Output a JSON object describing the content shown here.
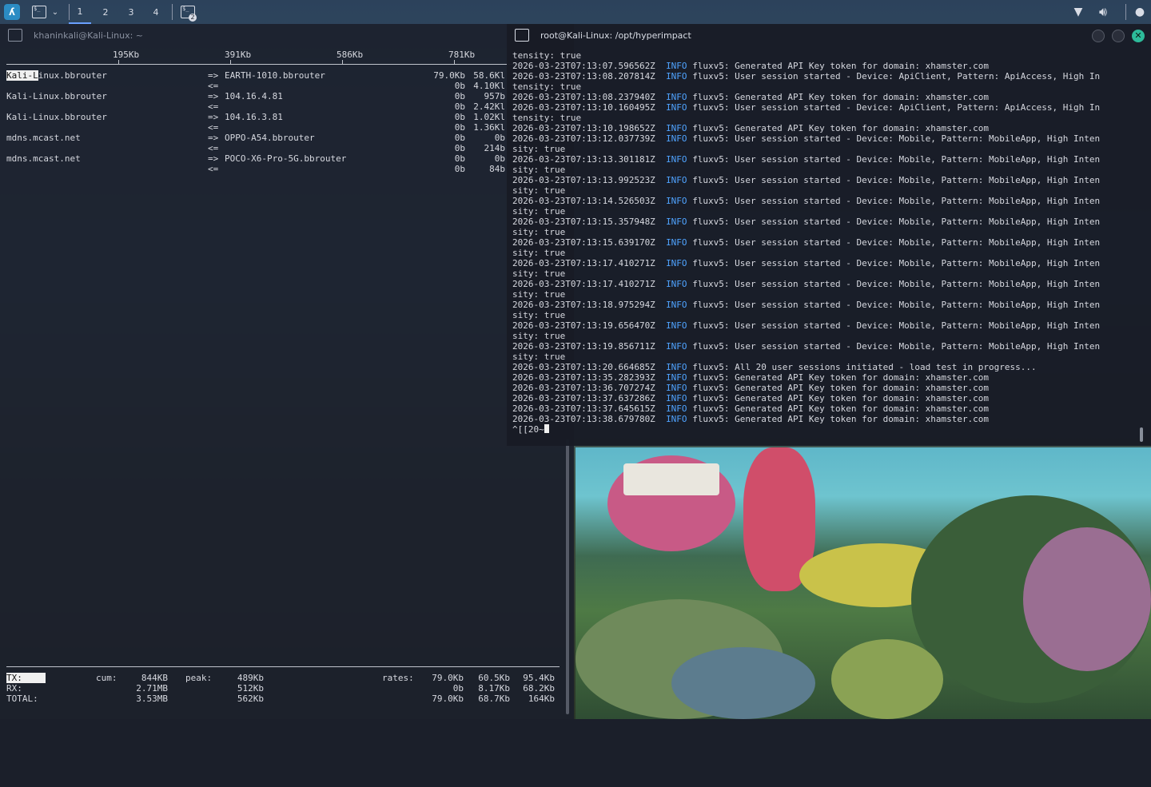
{
  "colors": {
    "accent": "#4fa3ff",
    "close": "#2dbb9a",
    "terminal_bg": "#181b25"
  },
  "top_panel": {
    "workspaces": [
      "1",
      "2",
      "3",
      "4"
    ],
    "active_workspace": "1",
    "task_badge": "2",
    "icons": [
      "kali-menu-icon",
      "terminal-icon",
      "chevron-down-icon",
      "network-icon",
      "volume-icon",
      "app-icon"
    ]
  },
  "left_window": {
    "title": "khaninkali@Kali-Linux: ~",
    "scale": [
      "195Kb",
      "391Kb",
      "586Kb",
      "781Kb"
    ],
    "flows": [
      {
        "src_hl": "Kali-L",
        "src": "inux.bbrouter",
        "arrow_out": "=>",
        "dst": "EARTH-1010.bbrouter",
        "arrow_in": "<=",
        "out_r1": "79.0Kb",
        "out_r2": "58.6Kl",
        "in_r1": "0b",
        "in_r2": "4.10Kl"
      },
      {
        "src_hl": "",
        "src": "Kali-Linux.bbrouter",
        "arrow_out": "=>",
        "dst": "104.16.4.81",
        "arrow_in": "<=",
        "out_r1": "0b",
        "out_r2": "957b",
        "in_r1": "0b",
        "in_r2": "2.42Kl"
      },
      {
        "src_hl": "",
        "src": "Kali-Linux.bbrouter",
        "arrow_out": "=>",
        "dst": "104.16.3.81",
        "arrow_in": "<=",
        "out_r1": "0b",
        "out_r2": "1.02Kl",
        "in_r1": "0b",
        "in_r2": "1.36Kl"
      },
      {
        "src_hl": "",
        "src": "mdns.mcast.net",
        "arrow_out": "=>",
        "dst": "OPPO-A54.bbrouter",
        "arrow_in": "<=",
        "out_r1": "0b",
        "out_r2": "0b",
        "in_r1": "0b",
        "in_r2": "214b"
      },
      {
        "src_hl": "",
        "src": "mdns.mcast.net",
        "arrow_out": "=>",
        "dst": "POCO-X6-Pro-5G.bbrouter",
        "arrow_in": "<=",
        "out_r1": "0b",
        "out_r2": "0b",
        "in_r1": "0b",
        "in_r2": "84b"
      }
    ],
    "totals": {
      "cum_label": "cum:",
      "peak_label": "peak:",
      "rates_label": "rates:",
      "rows": [
        {
          "label": "TX:",
          "cum": "844KB",
          "peak": "489Kb",
          "r1": "79.0Kb",
          "r2": "60.5Kb",
          "r3": "95.4Kb"
        },
        {
          "label": "RX:",
          "cum": "2.71MB",
          "peak": "512Kb",
          "r1": "0b",
          "r2": "8.17Kb",
          "r3": "68.2Kb"
        },
        {
          "label": "TOTAL:",
          "cum": "3.53MB",
          "peak": "562Kb",
          "r1": "79.0Kb",
          "r2": "68.7Kb",
          "r3": "164Kb"
        }
      ]
    }
  },
  "right_window": {
    "title": "root@Kali-Linux: /opt/hyperimpact",
    "close_glyph": "✕",
    "lines": [
      {
        "ts": "",
        "lvl": "",
        "msg": "tensity: true"
      },
      {
        "ts": "2026-03-23T07:13:07.596562Z",
        "lvl": "INFO",
        "msg": "fluxv5: Generated API Key token for domain: xhamster.com"
      },
      {
        "ts": "2026-03-23T07:13:08.207814Z",
        "lvl": "INFO",
        "msg": "fluxv5: User session started - Device: ApiClient, Pattern: ApiAccess, High In"
      },
      {
        "ts": "",
        "lvl": "",
        "msg": "tensity: true"
      },
      {
        "ts": "2026-03-23T07:13:08.237940Z",
        "lvl": "INFO",
        "msg": "fluxv5: Generated API Key token for domain: xhamster.com"
      },
      {
        "ts": "2026-03-23T07:13:10.160495Z",
        "lvl": "INFO",
        "msg": "fluxv5: User session started - Device: ApiClient, Pattern: ApiAccess, High In"
      },
      {
        "ts": "",
        "lvl": "",
        "msg": "tensity: true"
      },
      {
        "ts": "2026-03-23T07:13:10.198652Z",
        "lvl": "INFO",
        "msg": "fluxv5: Generated API Key token for domain: xhamster.com"
      },
      {
        "ts": "2026-03-23T07:13:12.037739Z",
        "lvl": "INFO",
        "msg": "fluxv5: User session started - Device: Mobile, Pattern: MobileApp, High Inten"
      },
      {
        "ts": "",
        "lvl": "",
        "msg": "sity: true"
      },
      {
        "ts": "2026-03-23T07:13:13.301181Z",
        "lvl": "INFO",
        "msg": "fluxv5: User session started - Device: Mobile, Pattern: MobileApp, High Inten"
      },
      {
        "ts": "",
        "lvl": "",
        "msg": "sity: true"
      },
      {
        "ts": "2026-03-23T07:13:13.992523Z",
        "lvl": "INFO",
        "msg": "fluxv5: User session started - Device: Mobile, Pattern: MobileApp, High Inten"
      },
      {
        "ts": "",
        "lvl": "",
        "msg": "sity: true"
      },
      {
        "ts": "2026-03-23T07:13:14.526503Z",
        "lvl": "INFO",
        "msg": "fluxv5: User session started - Device: Mobile, Pattern: MobileApp, High Inten"
      },
      {
        "ts": "",
        "lvl": "",
        "msg": "sity: true"
      },
      {
        "ts": "2026-03-23T07:13:15.357948Z",
        "lvl": "INFO",
        "msg": "fluxv5: User session started - Device: Mobile, Pattern: MobileApp, High Inten"
      },
      {
        "ts": "",
        "lvl": "",
        "msg": "sity: true"
      },
      {
        "ts": "2026-03-23T07:13:15.639170Z",
        "lvl": "INFO",
        "msg": "fluxv5: User session started - Device: Mobile, Pattern: MobileApp, High Inten"
      },
      {
        "ts": "",
        "lvl": "",
        "msg": "sity: true"
      },
      {
        "ts": "2026-03-23T07:13:17.410271Z",
        "lvl": "INFO",
        "msg": "fluxv5: User session started - Device: Mobile, Pattern: MobileApp, High Inten"
      },
      {
        "ts": "",
        "lvl": "",
        "msg": "sity: true"
      },
      {
        "ts": "2026-03-23T07:13:17.410271Z",
        "lvl": "INFO",
        "msg": "fluxv5: User session started - Device: Mobile, Pattern: MobileApp, High Inten"
      },
      {
        "ts": "",
        "lvl": "",
        "msg": "sity: true"
      },
      {
        "ts": "2026-03-23T07:13:18.975294Z",
        "lvl": "INFO",
        "msg": "fluxv5: User session started - Device: Mobile, Pattern: MobileApp, High Inten"
      },
      {
        "ts": "",
        "lvl": "",
        "msg": "sity: true"
      },
      {
        "ts": "2026-03-23T07:13:19.656470Z",
        "lvl": "INFO",
        "msg": "fluxv5: User session started - Device: Mobile, Pattern: MobileApp, High Inten"
      },
      {
        "ts": "",
        "lvl": "",
        "msg": "sity: true"
      },
      {
        "ts": "2026-03-23T07:13:19.856711Z",
        "lvl": "INFO",
        "msg": "fluxv5: User session started - Device: Mobile, Pattern: MobileApp, High Inten"
      },
      {
        "ts": "",
        "lvl": "",
        "msg": "sity: true"
      },
      {
        "ts": "2026-03-23T07:13:20.664685Z",
        "lvl": "INFO",
        "msg": "fluxv5: All 20 user sessions initiated - load test in progress..."
      },
      {
        "ts": "2026-03-23T07:13:35.282393Z",
        "lvl": "INFO",
        "msg": "fluxv5: Generated API Key token for domain: xhamster.com"
      },
      {
        "ts": "2026-03-23T07:13:36.707274Z",
        "lvl": "INFO",
        "msg": "fluxv5: Generated API Key token for domain: xhamster.com"
      },
      {
        "ts": "2026-03-23T07:13:37.637286Z",
        "lvl": "INFO",
        "msg": "fluxv5: Generated API Key token for domain: xhamster.com"
      },
      {
        "ts": "2026-03-23T07:13:37.645615Z",
        "lvl": "INFO",
        "msg": "fluxv5: Generated API Key token for domain: xhamster.com"
      },
      {
        "ts": "2026-03-23T07:13:38.679780Z",
        "lvl": "INFO",
        "msg": "fluxv5: Generated API Key token for domain: xhamster.com"
      }
    ],
    "prompt": "^[[20~"
  }
}
